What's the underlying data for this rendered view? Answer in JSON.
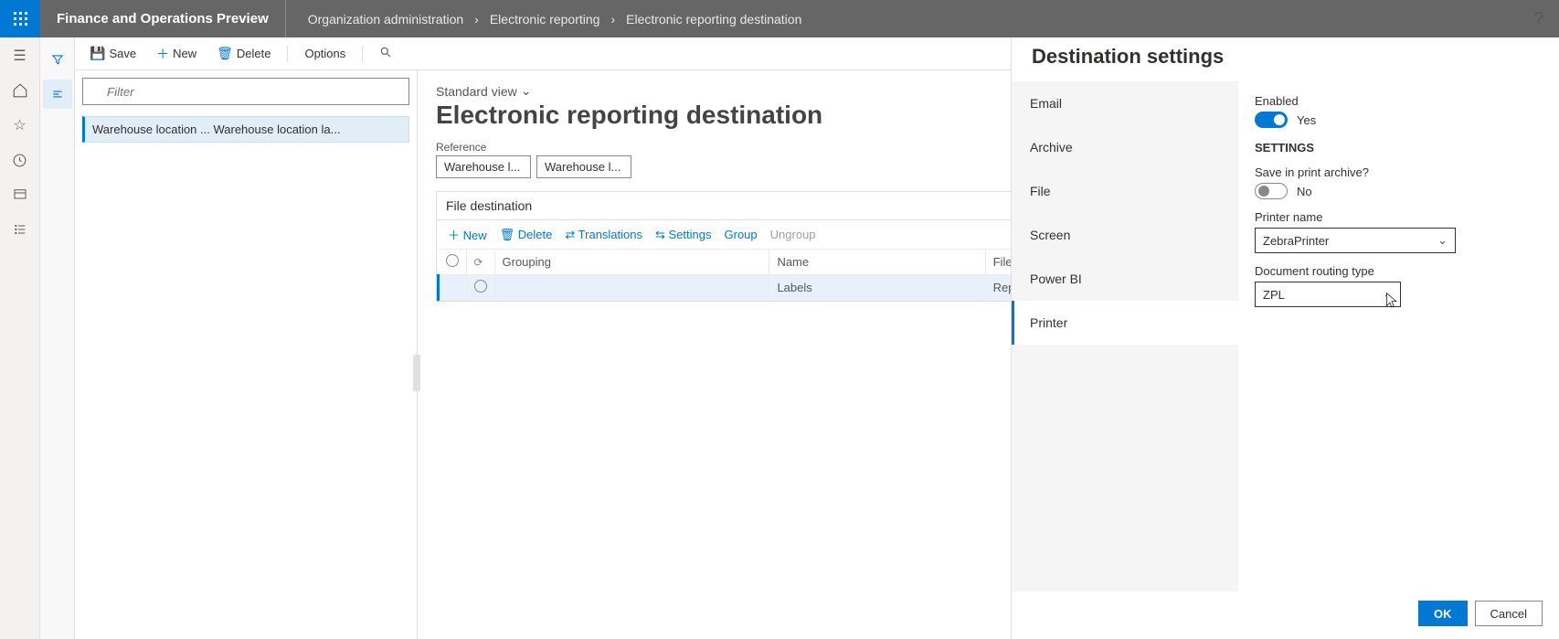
{
  "header": {
    "app_title": "Finance and Operations Preview",
    "breadcrumbs": [
      "Organization administration",
      "Electronic reporting",
      "Electronic reporting destination"
    ]
  },
  "actions": {
    "save": "Save",
    "new": "New",
    "delete": "Delete",
    "options": "Options"
  },
  "left": {
    "filter_placeholder": "Filter",
    "list_item": "Warehouse location ...   Warehouse location la..."
  },
  "main": {
    "view": "Standard view",
    "title": "Electronic reporting destination",
    "reference_label": "Reference",
    "ref1": "Warehouse l...",
    "ref2": "Warehouse l...",
    "section_title": "File destination",
    "toolbar": {
      "new": "New",
      "delete": "Delete",
      "translations": "Translations",
      "settings": "Settings",
      "group": "Group",
      "ungroup": "Ungroup"
    },
    "columns": {
      "grouping": "Grouping",
      "name": "Name",
      "file_component": "File component name"
    },
    "row": {
      "name": "Labels",
      "file_component": "Report"
    }
  },
  "panel": {
    "title": "Destination settings",
    "tabs": [
      "Email",
      "Archive",
      "File",
      "Screen",
      "Power BI",
      "Printer"
    ],
    "active_tab": "Printer",
    "enabled_label": "Enabled",
    "enabled_value": "Yes",
    "settings_header": "SETTINGS",
    "save_archive_label": "Save in print archive?",
    "save_archive_value": "No",
    "printer_name_label": "Printer name",
    "printer_name_value": "ZebraPrinter",
    "routing_label": "Document routing type",
    "routing_value": "ZPL",
    "ok": "OK",
    "cancel": "Cancel"
  }
}
